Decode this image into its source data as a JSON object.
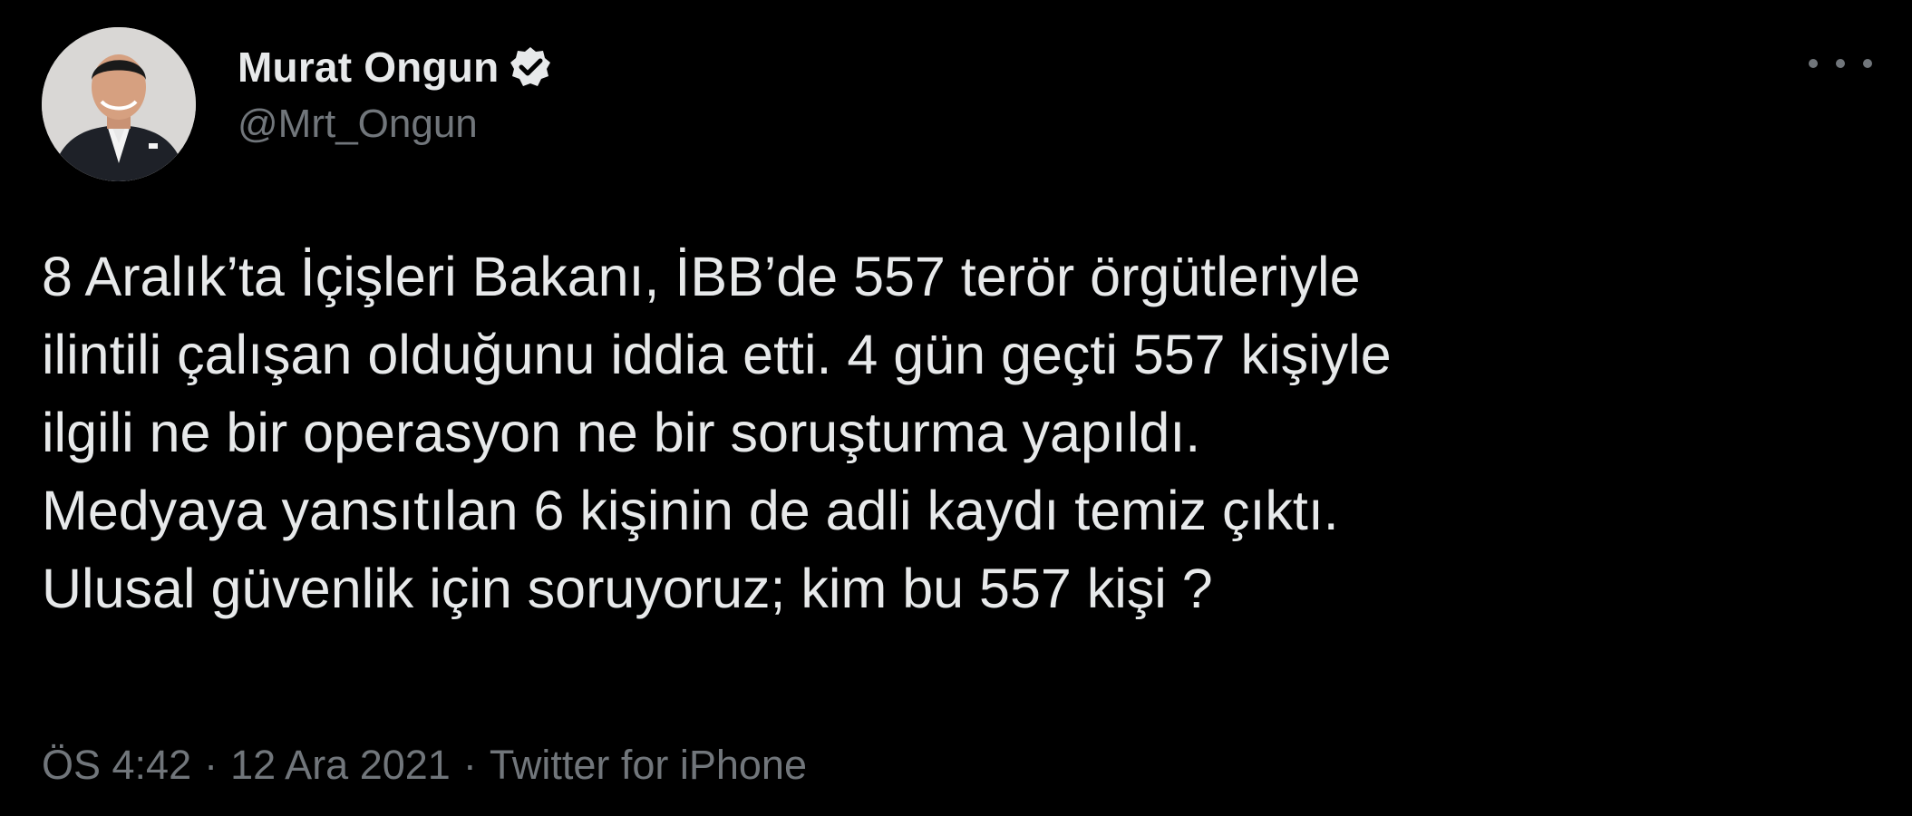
{
  "author": {
    "display_name": "Murat Ongun",
    "handle": "@Mrt_Ongun"
  },
  "tweet": {
    "text": "8 Aralık’ta İçişleri Bakanı, İBB’de 557 terör örgütleriyle\nilintili çalışan olduğunu iddia etti. 4 gün geçti 557 kişiyle\nilgili ne bir operasyon ne bir soruşturma yapıldı.\nMedyaya yansıtılan 6 kişinin de adli kaydı temiz çıktı.\nUlusal güvenlik için soruyoruz; kim bu 557 kişi ?"
  },
  "meta": {
    "time": "ÖS 4:42",
    "separator": "·",
    "date": "12 Ara 2021",
    "source": "Twitter for iPhone"
  },
  "icons": {
    "verified": "verified-badge-icon",
    "more": "more-options-icon"
  },
  "colors": {
    "background": "#000000",
    "text_primary": "#e7e9ea",
    "text_secondary": "#71767b"
  }
}
